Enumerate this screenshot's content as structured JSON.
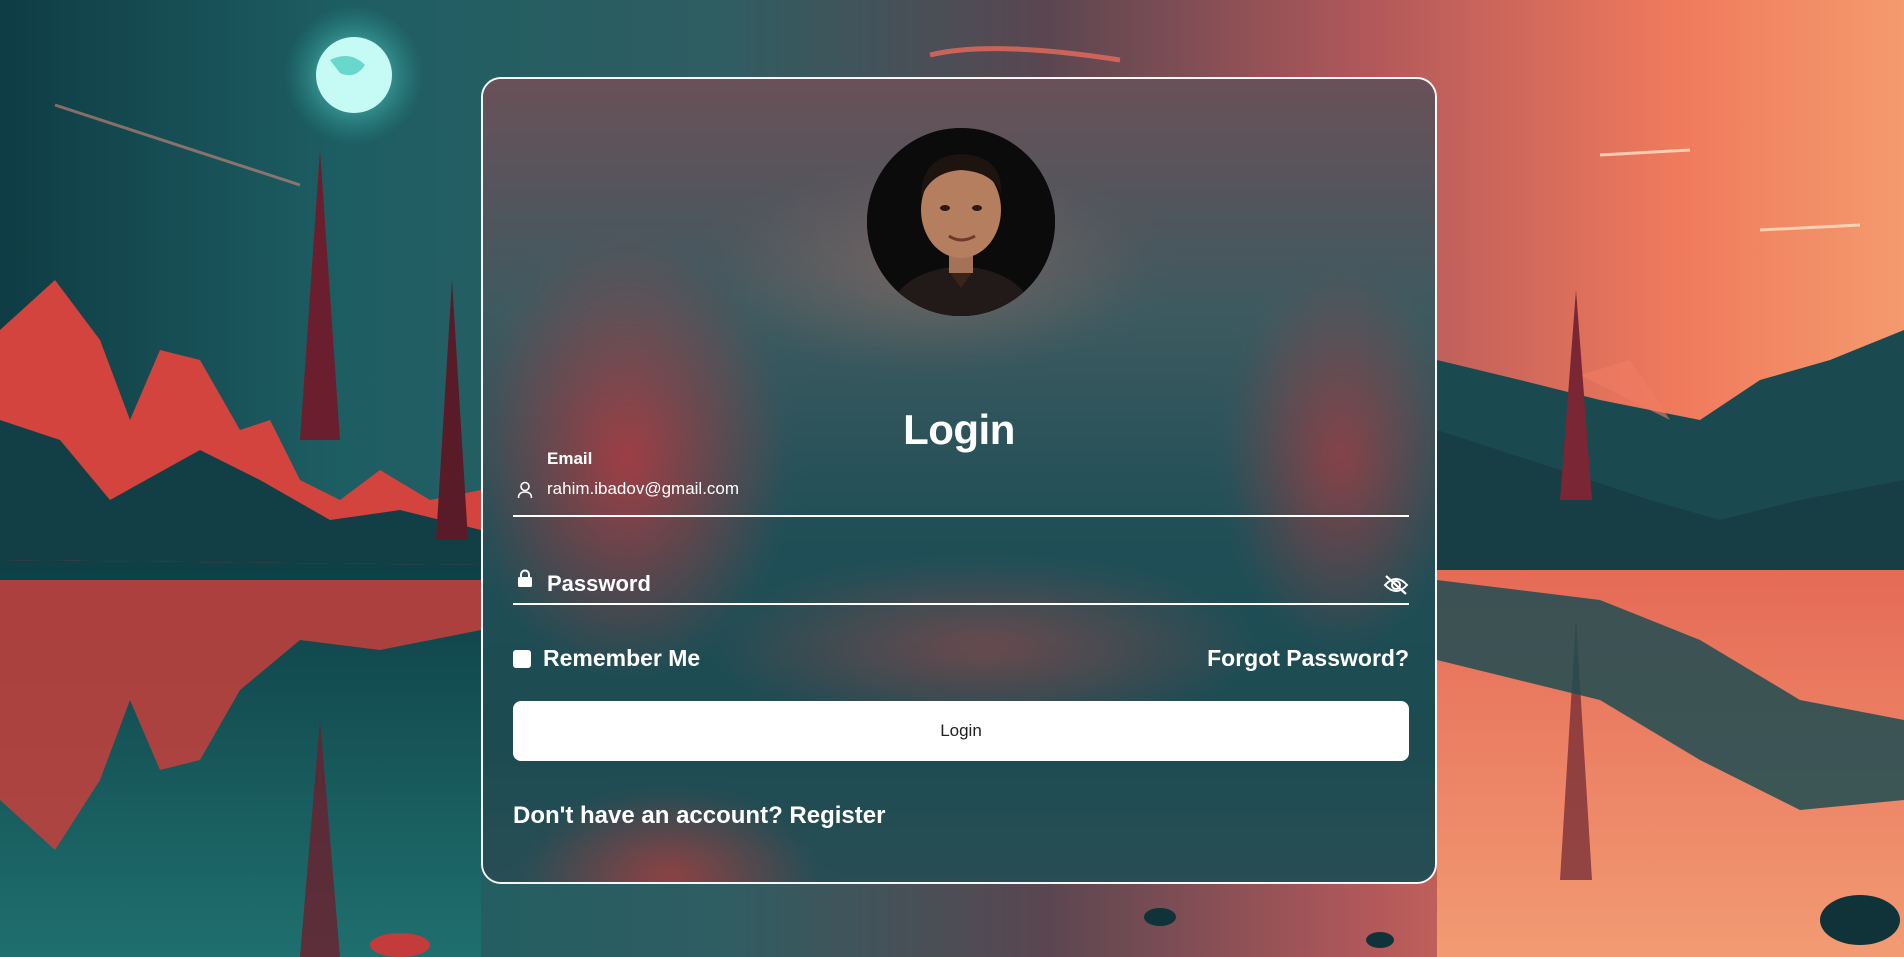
{
  "login_card": {
    "avatar_alt": "profile photo",
    "title": "Login",
    "email": {
      "label": "Email",
      "value": "rahim.ibadov@gmail.com",
      "icon": "user-icon"
    },
    "password": {
      "placeholder": "Password",
      "icon": "lock-icon",
      "toggle_icon": "eye-slash-icon"
    },
    "remember_label": "Remember Me",
    "remember_checked": false,
    "forgot_label": "Forgot Password?",
    "submit_label": "Login",
    "register_prompt": "Don't have an account?",
    "register_link": "Register"
  },
  "colors": {
    "card_border": "#ffffff",
    "button_bg": "#ffffff",
    "button_text": "#222222",
    "text": "#ffffff"
  }
}
